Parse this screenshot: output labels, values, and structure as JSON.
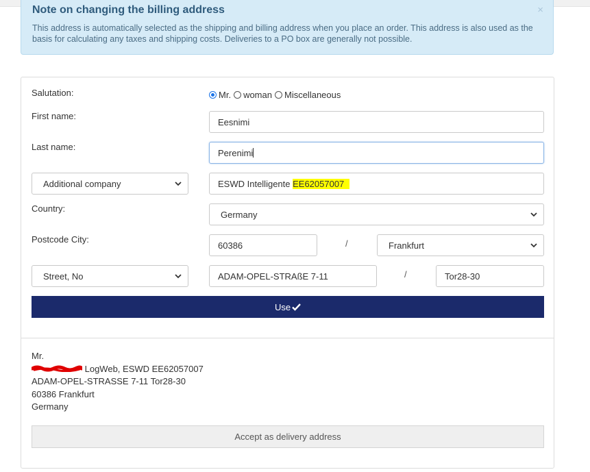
{
  "notice": {
    "title": "Note on changing the billing address",
    "body": "This address is automatically selected as the shipping and billing address when you place an order. This address is also used as the basis for calculating any taxes and shipping costs. Deliveries to a PO box are generally not possible.",
    "close_glyph": "×"
  },
  "form": {
    "salutation_label": "Salutation:",
    "salutation_options": [
      "Mr.",
      "woman",
      "Miscellaneous"
    ],
    "salutation_selected": "Mr.",
    "first_name_label": "First name:",
    "first_name_value": "Eesnimi",
    "last_name_label": "Last name:",
    "last_name_value": "Perenimi",
    "additional_select": "Additional company",
    "company_value_plain": "ESWD Intelligente ",
    "company_value_highlight": "EE62057007",
    "country_label": "Country:",
    "country_value": "Germany",
    "postcode_city_label": "Postcode City:",
    "postcode_value": "60386",
    "separator": "/",
    "city_value": "Frankfurt",
    "street_select": "Street, No",
    "street_value": "ADAM-OPEL-STRAßE 7-11",
    "house_no_value": "Tor28-30",
    "use_label": "Use"
  },
  "summary": {
    "line1": "Mr.",
    "line2_suffix": " LogWeb, ESWD EE62057007",
    "line3": "ADAM-OPEL-STRASSE 7-11 Tor28-30",
    "line4": "60386 Frankfurt",
    "line5": "Germany",
    "accept_label": "Accept as delivery address"
  },
  "colors": {
    "notice_bg": "#d6ebf7",
    "use_button": "#1b2a6b",
    "highlight": "#ffff00",
    "redaction": "#e00000"
  }
}
